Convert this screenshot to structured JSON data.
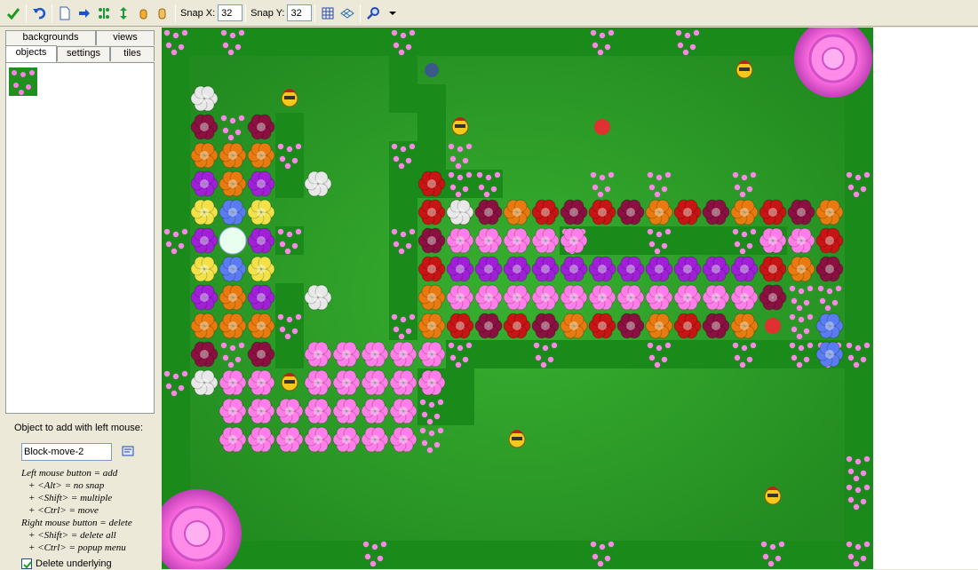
{
  "toolbar": {
    "snap_x_label": "Snap X:",
    "snap_x_value": "32",
    "snap_y_label": "Snap Y:",
    "snap_y_value": "32",
    "icons": [
      "check-icon",
      "undo-icon",
      "new-page-icon",
      "arrow-right-icon",
      "move-hv-icon",
      "move-v-icon",
      "hand-icon",
      "hand-alt-icon",
      "grid-icon",
      "isogrid-icon",
      "zoom-icon"
    ]
  },
  "tabs": {
    "backgrounds": "backgrounds",
    "views": "views",
    "objects": "objects",
    "settings": "settings",
    "tiles": "tiles"
  },
  "object_panel": {
    "label": "Object to add with left mouse:",
    "object_name": "Block-move-2",
    "help": [
      "Left mouse button = add",
      "+ <Alt> = no snap",
      "+ <Shift> = multiple",
      "+ <Ctrl> = move",
      "Right mouse button = delete",
      "+ <Shift> = delete all",
      "+ <Ctrl> = popup menu"
    ],
    "delete_underlying": "Delete underlying",
    "delete_underlying_checked": true
  },
  "colors": {
    "grass": "#2fa12a",
    "grass_dark": "#1b7d1a",
    "hedge": "#1f8f1d",
    "pink_flower": "#ff7ee8",
    "red_flower": "#c81414",
    "orange_flower": "#e87a10",
    "purple_flower": "#a020d8",
    "yellow_flower": "#f2e24a",
    "blue_flower": "#5a7cf0"
  }
}
